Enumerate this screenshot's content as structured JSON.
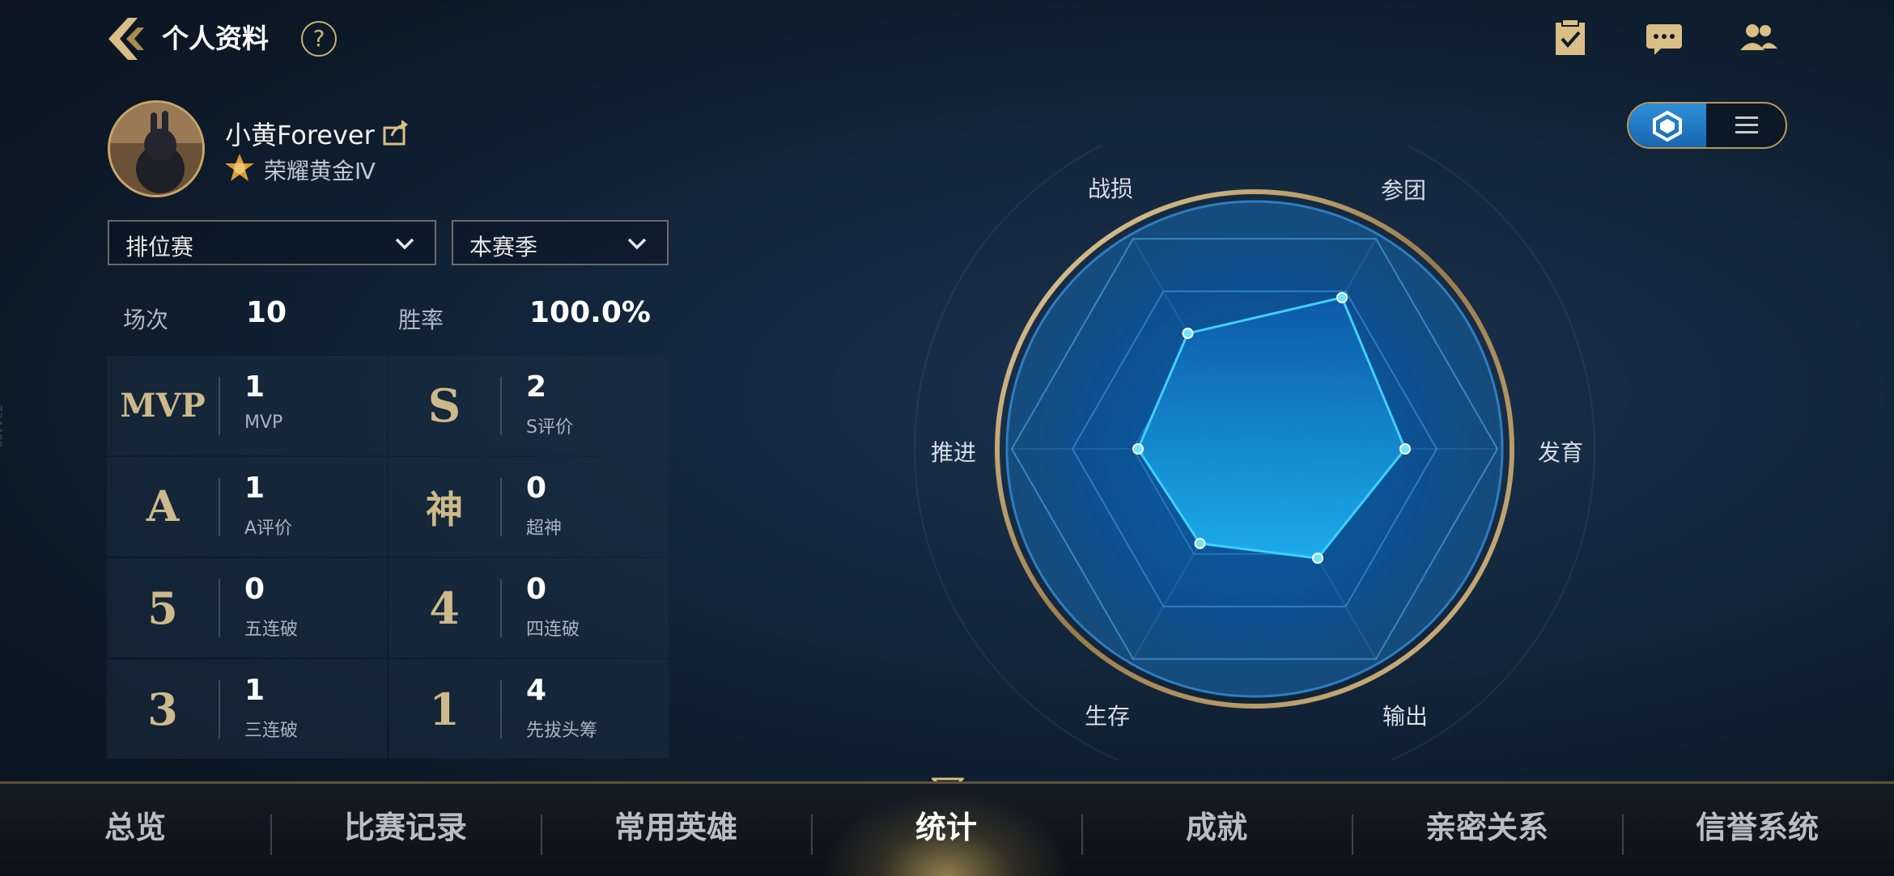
{
  "header": {
    "title": "个人资料",
    "help": "?",
    "icons": [
      "task-icon",
      "chat-icon",
      "friends-icon"
    ]
  },
  "profile": {
    "name": "小黄Forever",
    "rank": "荣耀黄金Ⅳ"
  },
  "filters": {
    "mode": "排位赛",
    "season": "本赛季"
  },
  "summary": {
    "matches_label": "场次",
    "matches_value": "10",
    "winrate_label": "胜率",
    "winrate_value": "100.0%"
  },
  "stats": [
    {
      "badge": "MVP",
      "value": "1",
      "caption": "MVP"
    },
    {
      "badge": "S",
      "value": "2",
      "caption": "S评价"
    },
    {
      "badge": "A",
      "value": "1",
      "caption": "A评价"
    },
    {
      "badge": "神",
      "value": "0",
      "caption": "超神"
    },
    {
      "badge": "5",
      "value": "0",
      "caption": "五连破"
    },
    {
      "badge": "4",
      "value": "0",
      "caption": "四连破"
    },
    {
      "badge": "3",
      "value": "1",
      "caption": "三连破"
    },
    {
      "badge": "1",
      "value": "4",
      "caption": "先拔头筹"
    }
  ],
  "chart_data": {
    "type": "radar",
    "axes": [
      "参团",
      "发育",
      "输出",
      "生存",
      "推进",
      "战损"
    ],
    "values": [
      0.72,
      0.62,
      0.52,
      0.45,
      0.48,
      0.55
    ],
    "max": 1
  },
  "nav": {
    "items": [
      "总览",
      "比赛记录",
      "常用英雄",
      "统计",
      "成就",
      "亲密关系",
      "信誉系统"
    ],
    "active": "统计"
  },
  "watermark": "734488",
  "colors": {
    "accent_gold": "#c9a56a",
    "radar_fill": "#1a8fe0",
    "radar_line": "#3fd0ff"
  }
}
